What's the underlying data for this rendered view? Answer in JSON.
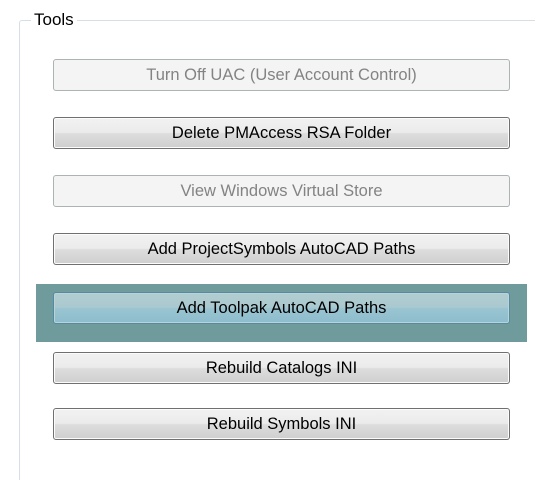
{
  "groupbox": {
    "title": "Tools"
  },
  "buttons": [
    {
      "label": "Turn Off UAC (User Account Control)",
      "enabled": false
    },
    {
      "label": "Delete PMAccess RSA Folder",
      "enabled": true
    },
    {
      "label": "View Windows Virtual Store",
      "enabled": false
    },
    {
      "label": "Add ProjectSymbols AutoCAD Paths",
      "enabled": true
    },
    {
      "label": "Add Toolpak AutoCAD Paths",
      "enabled": true,
      "highlighted": true
    },
    {
      "label": "Rebuild Catalogs INI",
      "enabled": true
    },
    {
      "label": "Rebuild Symbols INI",
      "enabled": true
    }
  ],
  "colors": {
    "highlight": "#6f9b9c",
    "groupbox_border": "#d5dfe5",
    "disabled_text": "#838383"
  }
}
